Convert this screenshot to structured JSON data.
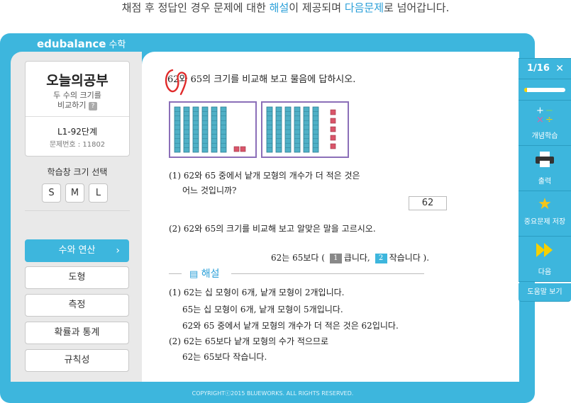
{
  "caption": {
    "part1": "채점 후 정답인 경우 문제에 대한 ",
    "hl1": "해설",
    "part2": "이 제공되며 ",
    "hl2": "다음문제",
    "part3": "로 넘어갑니다."
  },
  "app": {
    "logo": "edubalance",
    "logo_sub": "수학"
  },
  "lesson": {
    "title": "오늘의공부",
    "desc_line1": "두 수의 크기를",
    "desc_line2": "비교하기",
    "help_badge": "?",
    "level": "L1-92단계",
    "problem_number": "문제번호 : 11802"
  },
  "size_select": {
    "label": "학습창 크기 선택",
    "options": [
      "S",
      "M",
      "L"
    ]
  },
  "categories": [
    {
      "label": "수와 연산",
      "active": true
    },
    {
      "label": "도형",
      "active": false
    },
    {
      "label": "측정",
      "active": false
    },
    {
      "label": "확률과 통계",
      "active": false
    },
    {
      "label": "규칙성",
      "active": false
    }
  ],
  "question": {
    "title": "62와 65의 크기를 비교해 보고 물음에 답하시오.",
    "blocks": [
      {
        "tens": 6,
        "ones": 2
      },
      {
        "tens": 6,
        "ones": 5
      }
    ],
    "q1_line1": "(1) 62와 65 중에서 낱개 모형의 개수가 더 적은 것은",
    "q1_line2": "어느 것입니까?",
    "q1_answer": "62",
    "q2": "(2) 62와 65의 크기를 비교해 보고 알맞은 말을 고르시오.",
    "q2_pre": "62는 65보다 (",
    "choice1_num": "1",
    "choice1": "큽니다,",
    "choice2_num": "2",
    "choice2": "작습니다 )."
  },
  "explanation": {
    "title": "해설",
    "lines": [
      "(1) 62는 십 모형이 6개, 낱개 모형이 2개입니다.",
      "65는 십 모형이 6개, 낱개 모형이 5개입니다.",
      "62와 65 중에서 낱개 모형의 개수가 더 적은 것은 62입니다.",
      "(2) 62는 65보다 낱개 모형의 수가 적으므로",
      "62는 65보다 작습니다."
    ]
  },
  "nav": {
    "page": "1/16",
    "close_icon": "close-icon",
    "progress": 0.0625,
    "progress_color": "#f5d000",
    "items": [
      {
        "label": "개념학습",
        "icon": "math-operators-icon"
      },
      {
        "label": "출력",
        "icon": "printer-icon"
      },
      {
        "label": "중요문제 저장",
        "icon": "star-icon"
      },
      {
        "label": "다음",
        "icon": "double-arrow-icon"
      }
    ],
    "help": "도움말 보기"
  },
  "footer": "COPYRIGHTⓒ2015 BLUEWORKS. ALL RIGHTS RESERVED.",
  "colors": {
    "accent": "#3db6dd",
    "block": "#4fb0c6",
    "ones": "#d9556a",
    "box_border": "#8b6fb8",
    "mark": "#e02a2a"
  }
}
